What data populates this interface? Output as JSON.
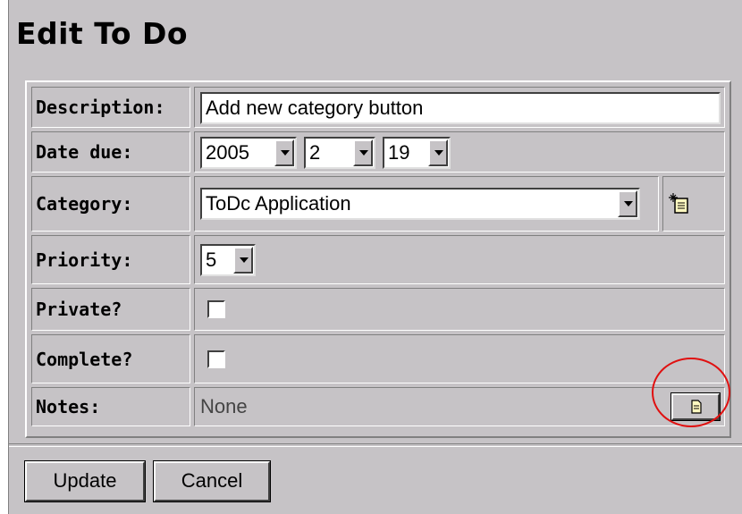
{
  "page": {
    "title": "Edit To Do"
  },
  "form": {
    "description": {
      "label": "Description:",
      "value": "Add new category button"
    },
    "date_due": {
      "label": "Date due:",
      "year": "2005",
      "month": "2",
      "day": "19"
    },
    "category": {
      "label": "Category:",
      "value": "ToDc Application",
      "new_icon": "new-category-icon"
    },
    "priority": {
      "label": "Priority:",
      "value": "5"
    },
    "private": {
      "label": "Private?",
      "checked": false
    },
    "complete": {
      "label": "Complete?",
      "checked": false
    },
    "notes": {
      "label": "Notes:",
      "value": "None",
      "button_icon": "edit-notes-icon"
    }
  },
  "actions": {
    "update_label": "Update",
    "cancel_label": "Cancel"
  },
  "colors": {
    "background": "#c6c3c6",
    "highlight": "#e01010"
  }
}
